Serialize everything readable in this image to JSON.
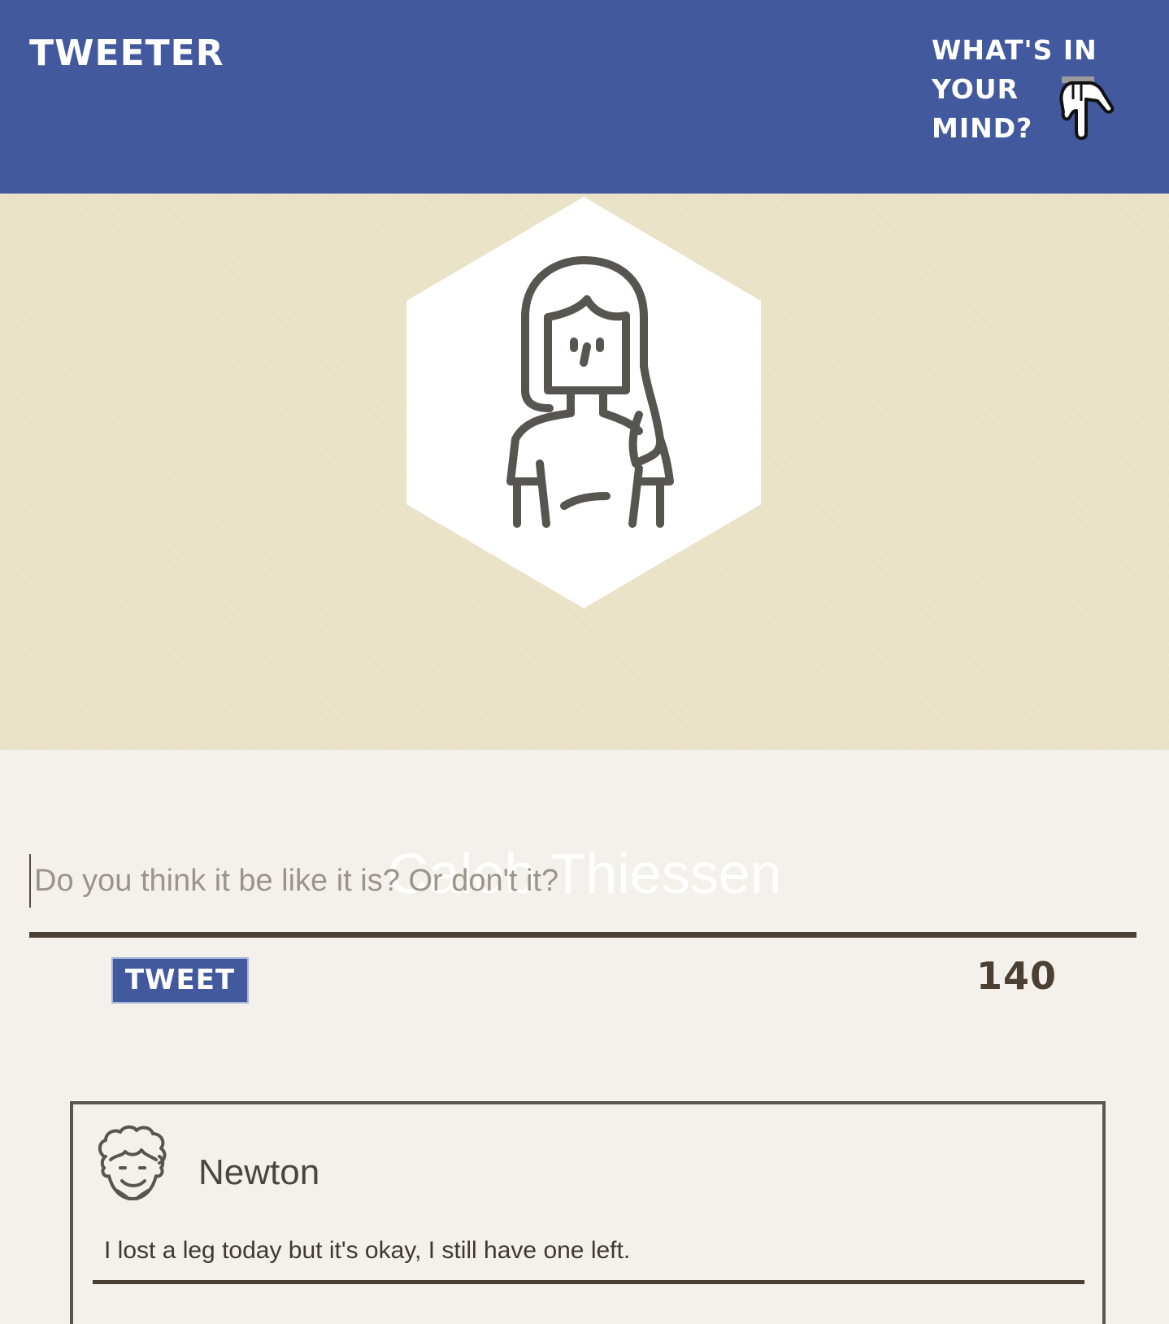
{
  "header": {
    "brand": "TWEETER",
    "prompt_lines": [
      "WHAT'S IN",
      "YOUR",
      "MIND?"
    ],
    "prompt_icon": "pointing-hand-icon"
  },
  "profile": {
    "name": "Caleb Thiessen",
    "avatar_icon": "woman-avatar-icon"
  },
  "compose": {
    "placeholder": "Do you think it be like it is? Or don't it?",
    "value": "",
    "button_label": "TWEET",
    "chars_remaining": "140"
  },
  "feed": [
    {
      "author": "Newton",
      "avatar_icon": "curly-hair-avatar-icon",
      "text": "I lost a leg today but it's okay, I still have one left."
    }
  ],
  "colors": {
    "header_bg": "#42599e",
    "banner_bg": "#e9e2c6",
    "page_bg": "#f4f1ec",
    "dark_brown": "#4c4035"
  }
}
